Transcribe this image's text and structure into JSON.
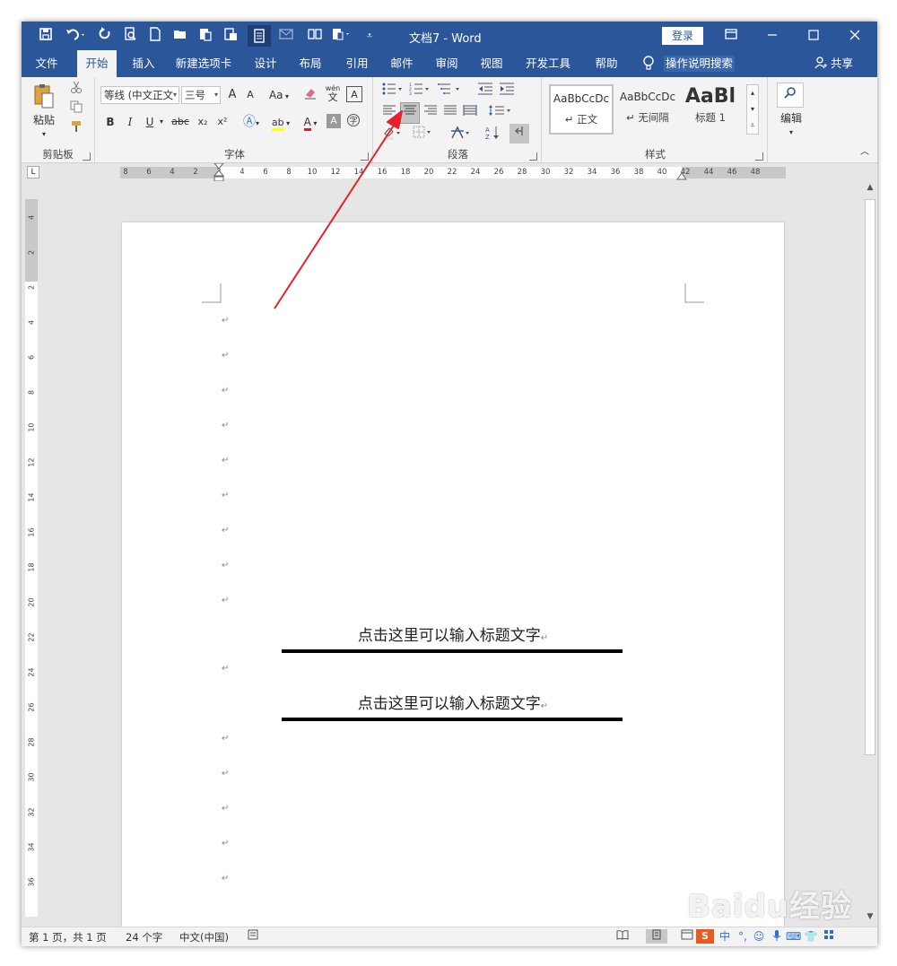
{
  "window": {
    "doc_title": "文档7 - Word",
    "login_label": "登录",
    "quick_access": [
      "save-icon",
      "undo-icon",
      "redo-icon",
      "print-preview-icon",
      "new-document-icon",
      "open-folder-icon",
      "paste-special-icon",
      "ruler-icon",
      "reading-mode-icon",
      "email-icon",
      "columns-icon",
      "document-properties-icon",
      "customize-icon"
    ]
  },
  "tabs": [
    {
      "label": "文件"
    },
    {
      "label": "开始"
    },
    {
      "label": "插入"
    },
    {
      "label": "新建选项卡"
    },
    {
      "label": "设计"
    },
    {
      "label": "布局"
    },
    {
      "label": "引用"
    },
    {
      "label": "邮件"
    },
    {
      "label": "审阅"
    },
    {
      "label": "视图"
    },
    {
      "label": "开发工具"
    },
    {
      "label": "帮助"
    }
  ],
  "active_tab": "开始",
  "tell_me": "操作说明搜索",
  "share_label": "共享",
  "ribbon": {
    "clipboard": {
      "label": "剪贴板",
      "paste_label": "粘贴"
    },
    "font": {
      "label": "字体",
      "font_name": "等线 (中文正文",
      "font_size": "三号",
      "bold": "B",
      "italic": "I",
      "underline": "U",
      "strike": "abc",
      "subscript": "x₂",
      "superscript": "x²",
      "change_case": "Aa",
      "grow": "A",
      "shrink": "A",
      "font_color": "A",
      "char_shading": "A",
      "highlight": "ab",
      "phonetic": "wén"
    },
    "paragraph": {
      "label": "段落"
    },
    "styles": {
      "label": "样式",
      "items": [
        {
          "preview": "AaBbCcDc",
          "name": "↵ 正文"
        },
        {
          "preview": "AaBbCcDc",
          "name": "↵ 无间隔"
        },
        {
          "preview": "AaBl",
          "name": "标题 1"
        }
      ]
    },
    "editing": {
      "label": "编辑"
    }
  },
  "ruler": {
    "h_ticks": [
      "8",
      "6",
      "4",
      "2",
      "2",
      "4",
      "6",
      "8",
      "10",
      "12",
      "14",
      "16",
      "18",
      "20",
      "22",
      "24",
      "26",
      "28",
      "30",
      "32",
      "34",
      "36",
      "38",
      "40",
      "42",
      "44",
      "46",
      "48"
    ],
    "v_ticks": [
      "4",
      "2",
      "2",
      "4",
      "6",
      "8",
      "10",
      "12",
      "14",
      "16",
      "18",
      "20",
      "22",
      "24",
      "26",
      "28",
      "30",
      "32",
      "34",
      "36"
    ]
  },
  "document": {
    "heading1": "点击这里可以输入标题文字",
    "heading2": "点击这里可以输入标题文字",
    "para_mark": "↵"
  },
  "statusbar": {
    "page": "第 1 页，共 1 页",
    "words": "24 个字",
    "language": "中文(中国)"
  },
  "colors": {
    "title_blue": "#2b579a",
    "ribbon_bg": "#f3f3f3",
    "arrow_red": "#e8202a"
  },
  "watermark": "Baidu经验"
}
